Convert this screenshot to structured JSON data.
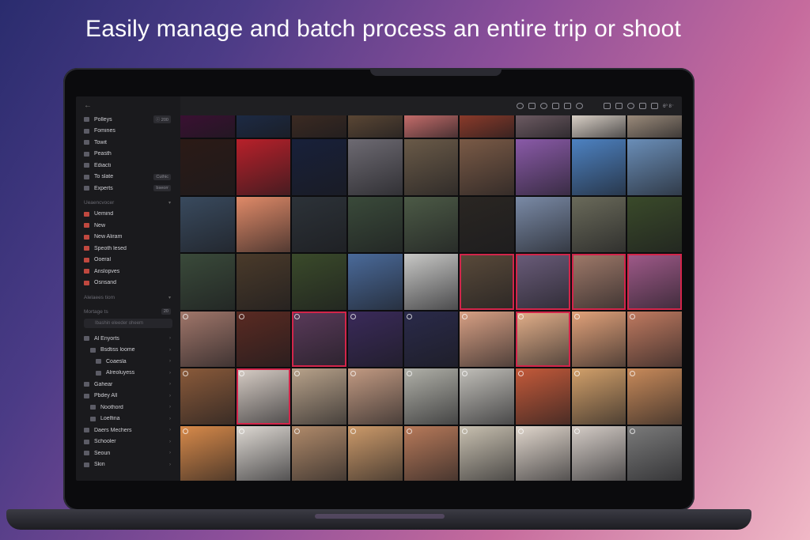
{
  "headline": "Easily manage and batch process an entire trip or shoot",
  "toolbar": {
    "right_text": "6⁰ 8⁻"
  },
  "sidebar": {
    "top_icon": "back-arrow-icon",
    "items": [
      {
        "label": "Polleys",
        "badge": "ⓘ 200"
      },
      {
        "label": "Fomines",
        "badge": ""
      },
      {
        "label": "Towit",
        "badge": ""
      },
      {
        "label": "Peasth",
        "badge": ""
      },
      {
        "label": "Ediacti",
        "badge": ""
      },
      {
        "label": "To slate",
        "badge": "Cuthic"
      },
      {
        "label": "Experts",
        "badge": "bseorr"
      }
    ],
    "section1": "Ueaencvocer",
    "red_items": [
      {
        "label": "Uemind"
      },
      {
        "label": "New"
      },
      {
        "label": "New Aliram"
      },
      {
        "label": "Speoth lesed"
      },
      {
        "label": "Ooeral"
      },
      {
        "label": "Anslopves"
      },
      {
        "label": "Osnsand"
      }
    ],
    "section2": "Alelaees tiom",
    "section3": "Mortage ts",
    "section3_badge": "20",
    "search_placeholder": "Ibashin eleeder oheem",
    "tree": [
      {
        "label": "Al Enyorts",
        "level": 0
      },
      {
        "label": "Bsdtiss loome",
        "level": 1
      },
      {
        "label": "Coaesla",
        "level": 2
      },
      {
        "label": "Alreoluyess",
        "level": 2
      },
      {
        "label": "Gahear",
        "level": 0
      },
      {
        "label": "Pbdey All",
        "level": 0
      },
      {
        "label": "Noothord",
        "level": 1
      },
      {
        "label": "Loelfina",
        "level": 1
      },
      {
        "label": "Daers Mechers",
        "level": 0
      },
      {
        "label": "Schooler",
        "level": 0
      },
      {
        "label": "Seoun",
        "level": 0
      },
      {
        "label": "Skin",
        "level": 0
      }
    ]
  },
  "tiles": [
    "#3a1032",
    "#1c2a44",
    "#3b2a22",
    "#5a4634",
    "#c46c6a",
    "#8a3a2a",
    "#6c5a62",
    "#d9d0c6",
    "#9a8a7a",
    "#2b1a16",
    "#b8202a",
    "#18203a",
    "#6d6a72",
    "#6a5a48",
    "#7a5a46",
    "#8a5aa8",
    "#4d82c2",
    "#6a8eb8",
    "#394a5e",
    "#e08a68",
    "#2c3238",
    "#3a4a3a",
    "#4c5a46",
    "#2a2622",
    "#7a8aa6",
    "#6a6a5a",
    "#3a4a2a",
    "#3a4a3a",
    "#4a3a2a",
    "#3a4a2a",
    "#4a6a9a",
    "#c8c8c6",
    "#5a4a3a",
    "#6a5c7a",
    "#a07a6a",
    "#a05a8a",
    "#a0766a",
    "#5a2a22",
    "#5a3a5a",
    "#3a2a5a",
    "#2a2a4a",
    "#d8a084",
    "#e4b08a",
    "#e2a27a",
    "#c07a60",
    "#8a5a3a",
    "#d8cec6",
    "#b8a28a",
    "#c29a82",
    "#b0b0a8",
    "#c0beb8",
    "#c45a3a",
    "#d2a06a",
    "#c88a5a",
    "#d88a4a",
    "#ddd8d2",
    "#b08a6a",
    "#cc9a6a",
    "#b87a5a",
    "#c8c0b0",
    "#e0d6cc",
    "#d4ccc6",
    "#7a7a7a"
  ],
  "selected": [
    32,
    33,
    34,
    35,
    38,
    42,
    46
  ]
}
